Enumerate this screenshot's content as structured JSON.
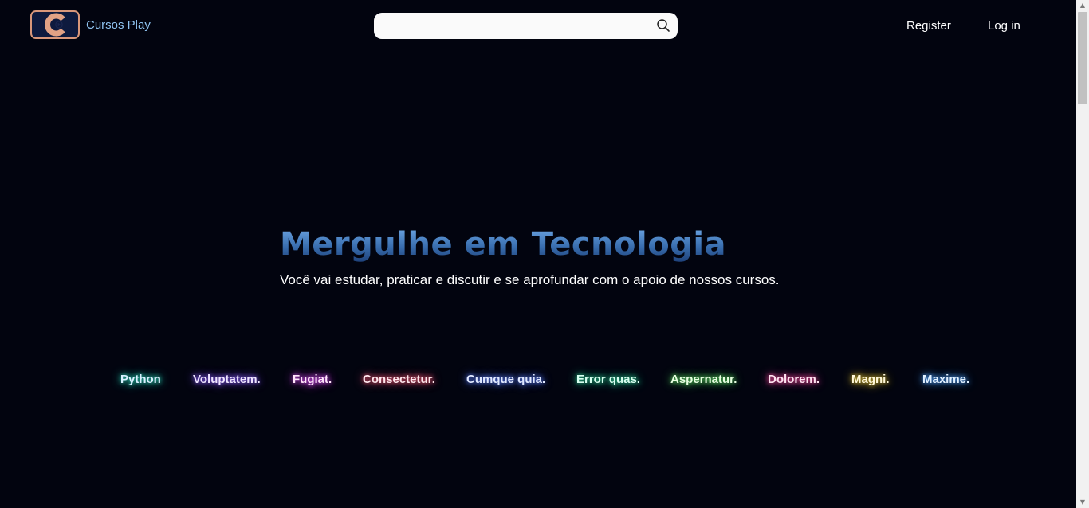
{
  "header": {
    "brand_name": "Cursos Play",
    "search": {
      "value": "",
      "placeholder": ""
    },
    "nav": {
      "register_label": "Register",
      "login_label": "Log in"
    }
  },
  "hero": {
    "title": "Mergulhe em Tecnologia",
    "subtitle": "Você vai estudar, praticar e discutir e se aprofundar com o apoio de nossos cursos."
  },
  "tags": [
    {
      "label": "Python",
      "color": "#d8f0ff",
      "glow": "#2fe0c0"
    },
    {
      "label": "Voluptatem.",
      "color": "#eee4ff",
      "glow": "#8a5cff"
    },
    {
      "label": "Fugiat.",
      "color": "#ffe4fb",
      "glow": "#e04cff"
    },
    {
      "label": "Consectetur.",
      "color": "#ffe6ec",
      "glow": "#ff5a78"
    },
    {
      "label": "Cumque quia.",
      "color": "#e0e8ff",
      "glow": "#5a7dff"
    },
    {
      "label": "Error quas.",
      "color": "#d8fff0",
      "glow": "#2fd89a"
    },
    {
      "label": "Aspernatur.",
      "color": "#e6ffe0",
      "glow": "#5ce060"
    },
    {
      "label": "Dolorem.",
      "color": "#ffe2f0",
      "glow": "#ff4ca0"
    },
    {
      "label": "Magni.",
      "color": "#fff8d8",
      "glow": "#e0c030"
    },
    {
      "label": "Maxime.",
      "color": "#e0f0ff",
      "glow": "#4ca0ff"
    }
  ],
  "icons": {
    "logo": "logo-c-play-icon",
    "search": "search-icon"
  },
  "colors": {
    "background": "#02040f",
    "brand_text": "#8fc3f0",
    "logo_accent": "#d9977a"
  }
}
